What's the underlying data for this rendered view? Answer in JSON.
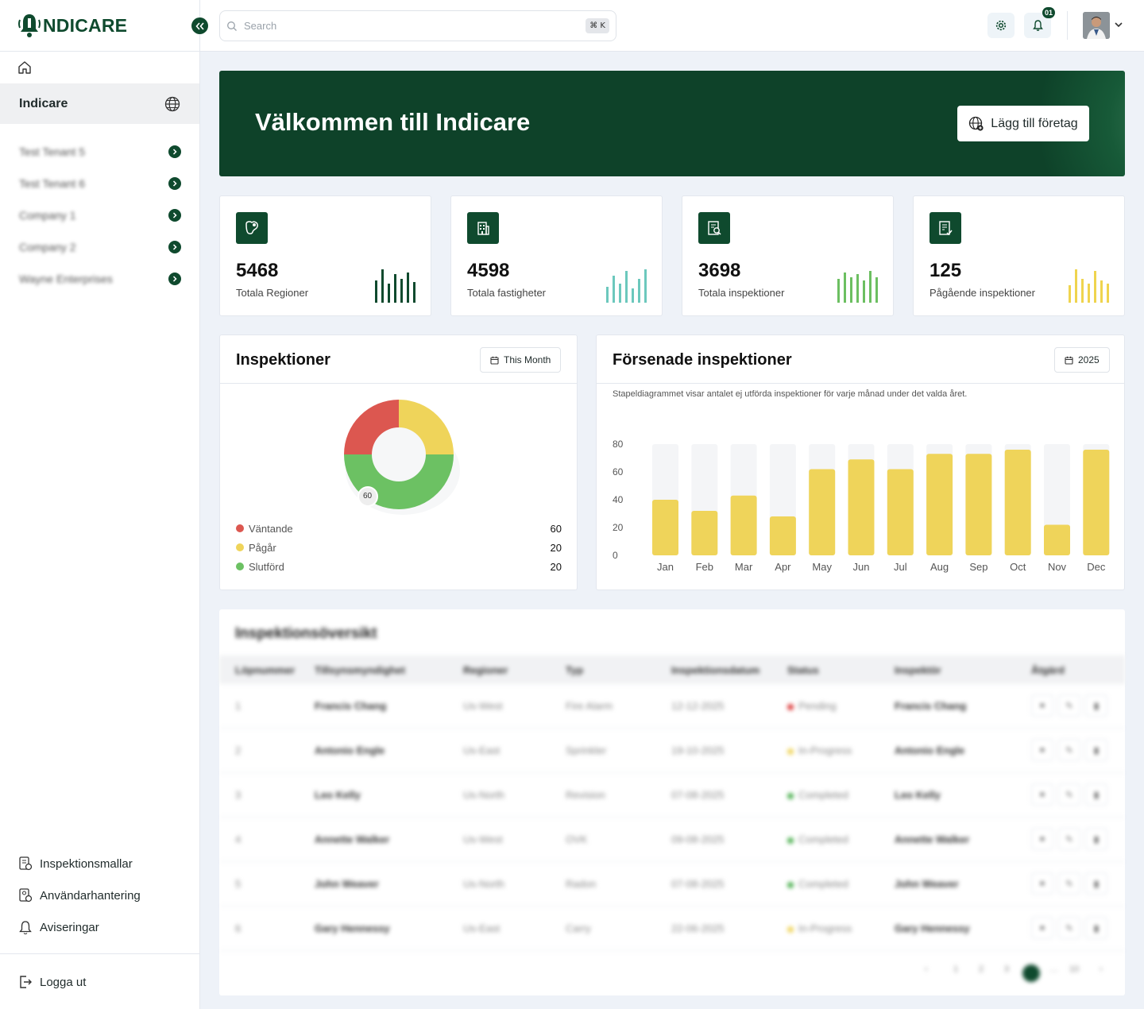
{
  "brand": {
    "logo_text": "NDICARE",
    "accent": "#0f4a2e"
  },
  "sidebar": {
    "active_label": "Indicare",
    "tenants": [
      "Test Tenant 5",
      "Test Tenant 6",
      "Company 1",
      "Company 2",
      "Wayne Enterprises"
    ],
    "links": [
      "Inspektionsmallar",
      "Användarhantering",
      "Aviseringar"
    ],
    "logout": "Logga ut"
  },
  "topbar": {
    "search_placeholder": "Search",
    "shortcut": "⌘ K",
    "notifications_count": "01"
  },
  "banner": {
    "title": "Välkommen till Indicare",
    "button": "Lägg till företag"
  },
  "stats": [
    {
      "value": "5468",
      "label": "Totala Regioner",
      "color": "#0f4a2e"
    },
    {
      "value": "4598",
      "label": "Totala fastigheter",
      "color": "#6cc8bd"
    },
    {
      "value": "3698",
      "label": "Totala inspektioner",
      "color": "#6cbf61"
    },
    {
      "value": "125",
      "label": "Pågående inspektioner",
      "color": "#efd44e"
    }
  ],
  "inspections_card": {
    "title": "Inspektioner",
    "filter": "This Month",
    "donut_label": "60",
    "legend": [
      {
        "label": "Väntande",
        "value": "60",
        "color": "#dc5750"
      },
      {
        "label": "Pågår",
        "value": "20",
        "color": "#efd45a"
      },
      {
        "label": "Slutförd",
        "value": "20",
        "color": "#6cc163"
      }
    ]
  },
  "delayed_card": {
    "title": "Försenade inspektioner",
    "filter": "2025",
    "subtitle": "Stapeldiagrammet visar antalet ej utförda inspektioner för varje månad under det valda året."
  },
  "chart_data": {
    "type": "bar",
    "title": "Försenade inspektioner",
    "categories": [
      "Jan",
      "Feb",
      "Mar",
      "Apr",
      "May",
      "Jun",
      "Jul",
      "Aug",
      "Sep",
      "Oct",
      "Nov",
      "Dec"
    ],
    "values": [
      40,
      32,
      43,
      28,
      62,
      69,
      62,
      73,
      73,
      76,
      22,
      76
    ],
    "ylim": [
      0,
      80
    ],
    "yticks": [
      "0",
      "20",
      "40",
      "60",
      "80"
    ],
    "grid": false,
    "bar_color": "#efd45a"
  },
  "table": {
    "title": "Inspektionsöversikt",
    "headers": [
      "Löpnummer",
      "Tillsynsmyndighet",
      "Regioner",
      "Typ",
      "Inspektionsdatum",
      "Status",
      "Inspektör",
      "Åtgärd"
    ],
    "rows": [
      {
        "no": "1",
        "authority": "Francis Chang",
        "region": "Us-West",
        "type": "Fire Alarm",
        "date": "12-12-2025",
        "status": "Pending",
        "status_color": "#dc3b3b",
        "inspector": "Francis Chang"
      },
      {
        "no": "2",
        "authority": "Antonio Engle",
        "region": "Us-East",
        "type": "Sprinkler",
        "date": "19-10-2025",
        "status": "In-Progress",
        "status_color": "#efd45a",
        "inspector": "Antonio Engle"
      },
      {
        "no": "3",
        "authority": "Leo Kelly",
        "region": "Us-North",
        "type": "Revision",
        "date": "07-08-2025",
        "status": "Completed",
        "status_color": "#4caf50",
        "inspector": "Leo Kelly"
      },
      {
        "no": "4",
        "authority": "Annette Walker",
        "region": "Us-West",
        "type": "OVK",
        "date": "09-08-2025",
        "status": "Completed",
        "status_color": "#4caf50",
        "inspector": "Annette Walker"
      },
      {
        "no": "5",
        "authority": "John Weaver",
        "region": "Us-North",
        "type": "Radon",
        "date": "07-08-2025",
        "status": "Completed",
        "status_color": "#4caf50",
        "inspector": "John Weaver"
      },
      {
        "no": "6",
        "authority": "Gary Hennessy",
        "region": "Us-East",
        "type": "Carry",
        "date": "22-06-2025",
        "status": "In-Progress",
        "status_color": "#efd45a",
        "inspector": "Gary Hennessy"
      }
    ],
    "pagination": [
      "‹",
      "1",
      "2",
      "3",
      "4",
      "…",
      "10",
      "›"
    ]
  }
}
